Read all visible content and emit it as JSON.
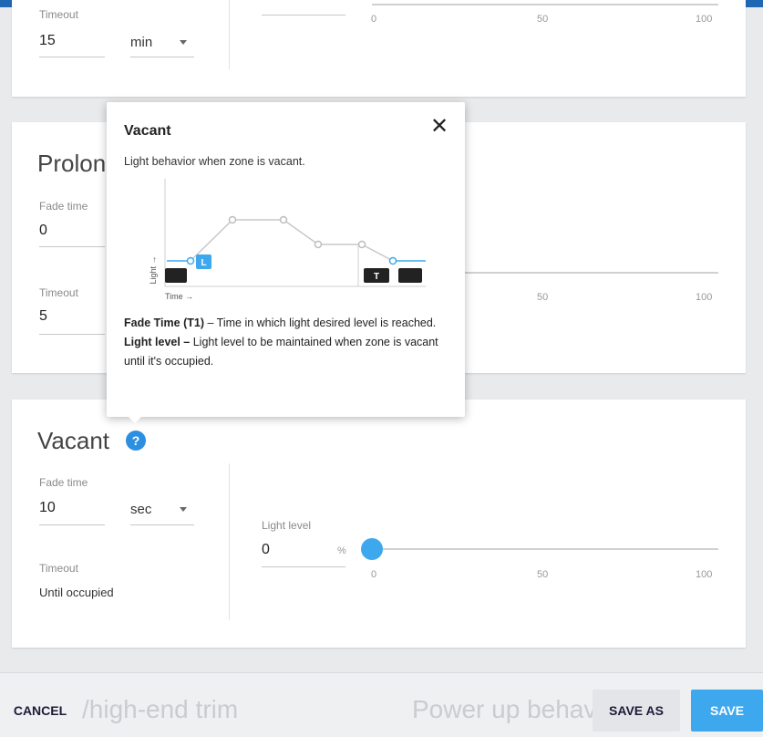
{
  "card_top": {
    "timeout_label": "Timeout",
    "timeout_value": "15",
    "timeout_unit": "min",
    "slider_ticks": [
      "0",
      "50",
      "100"
    ]
  },
  "prolong": {
    "title": "Prolon",
    "fade_label": "Fade time",
    "fade_value": "0",
    "timeout_label": "Timeout",
    "timeout_value": "5",
    "slider_ticks": [
      "50",
      "100"
    ]
  },
  "vacant": {
    "title": "Vacant",
    "help_glyph": "?",
    "fade_label": "Fade time",
    "fade_value": "10",
    "fade_unit": "sec",
    "timeout_label": "Timeout",
    "timeout_value": "Until occupied",
    "light_label": "Light level",
    "light_value": "0",
    "light_unit": "%",
    "slider_ticks": [
      "0",
      "50",
      "100"
    ],
    "slider_fraction": 0
  },
  "popover": {
    "title": "Vacant",
    "close_glyph": "✕",
    "description": "Light behavior when zone is vacant.",
    "diagram": {
      "y_axis": "Light →",
      "x_axis": "Time →",
      "marker_l": "L",
      "marker_t": "T"
    },
    "fade_term": "Fade Time (T1)",
    "fade_text": " – Time in which light desired level is reached.",
    "light_term": "Light level –",
    "light_text": " Light level to be maintained when zone is vacant until it's occupied."
  },
  "footer": {
    "ghost_left": "/high-end trim",
    "ghost_right": "Power up behav",
    "cancel_label": "CANCEL",
    "save_as_label": "SAVE AS",
    "save_label": "SAVE"
  },
  "colors": {
    "accent": "#3ea8ee",
    "topbar": "#1f66b3",
    "help": "#2d8fe0"
  }
}
